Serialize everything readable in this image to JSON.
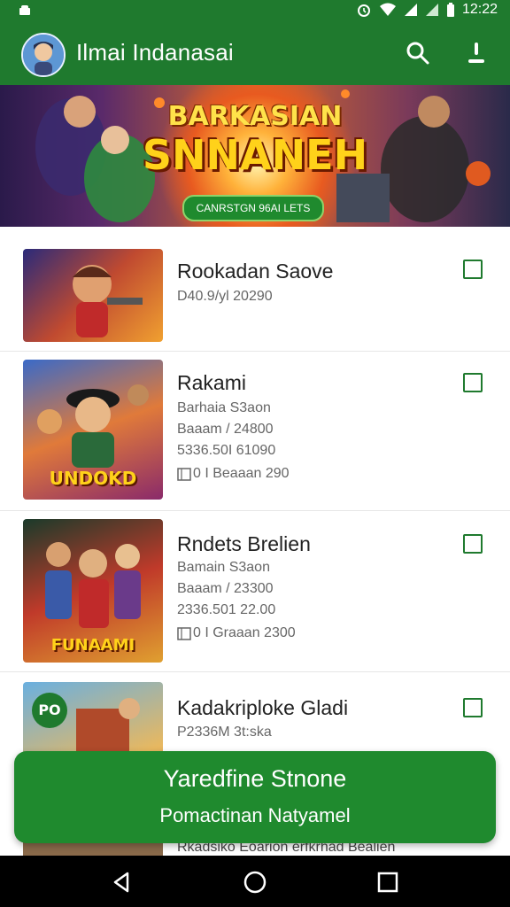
{
  "status_bar": {
    "time": "12:22"
  },
  "app_bar": {
    "title": "Ilmai Indanasai",
    "avatar_icon": "avatar",
    "search_icon": "search-icon",
    "download_icon": "download-icon"
  },
  "banner": {
    "title_line1": "BARKASIAN",
    "title_line2": "SNNANEH",
    "cta_label": "CANRSTGN 96AI LETS"
  },
  "list": {
    "items": [
      {
        "title": "Rookadan Saove",
        "lines": [
          "D40.9/yl 20290"
        ]
      },
      {
        "title": "Rakami",
        "lines": [
          "Barhaia S3aon",
          "Baaam / 24800",
          "5336.50I 61090",
          "0 I Beaaan 290"
        ],
        "thumb_label": "UNDOKD"
      },
      {
        "title": "Rndets Brelien",
        "lines": [
          "Bamain S3aon",
          "Baaam / 23300",
          "2336.501 22.00",
          "0 I Graaan 2300"
        ],
        "thumb_label": "FUNAAMI"
      },
      {
        "title": "Kadakriploke Gladi",
        "lines": [
          "P2336M 3t:ska"
        ],
        "thumb_label": "PO"
      }
    ],
    "partial_line": "Rkadsiko Eoarion erfkrhad Bealien"
  },
  "snackbar": {
    "title": "Yaredfine Stnone",
    "subtitle": "Pomactinan Natyamel"
  },
  "colors": {
    "primary": "#1f7a2e",
    "accent": "#1f8a2e"
  }
}
